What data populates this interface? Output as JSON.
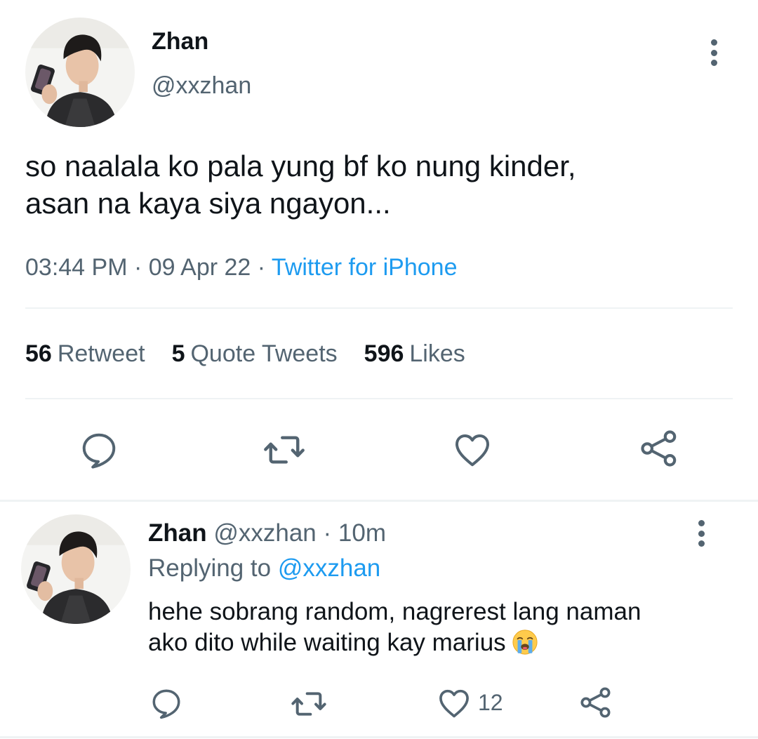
{
  "tweet": {
    "author_name": "Zhan",
    "author_handle": "@xxzhan",
    "text_line1": "so naalala ko pala yung bf ko nung kinder,",
    "text_line2": "asan na kaya siya ngayon...",
    "time": "03:44 PM",
    "sep1": " · ",
    "date": "09 Apr 22",
    "sep2": " · ",
    "source": "Twitter for iPhone",
    "stats": {
      "retweets_count": "56",
      "retweets_label": "Retweet",
      "quotes_count": "5",
      "quotes_label": "Quote Tweets",
      "likes_count": "596",
      "likes_label": "Likes"
    },
    "actions": [
      "reply-icon",
      "retweet-icon",
      "like-icon",
      "share-icon"
    ]
  },
  "reply": {
    "author_name": "Zhan",
    "author_handle": "@xxzhan",
    "sep": " · ",
    "time_ago": "10m",
    "replying_label": "Replying to ",
    "replying_to": "@xxzhan",
    "text_line1": "hehe sobrang random, nagrerest lang naman",
    "text_line2": "ako dito while waiting kay marius",
    "emoji": "loudly-crying-face-emoji",
    "like_count": "12",
    "actions": [
      "reply-icon",
      "retweet-icon",
      "like-icon",
      "share-icon"
    ]
  },
  "colors": {
    "text_primary": "#0f1419",
    "text_secondary": "#536471",
    "accent": "#1d9bf0",
    "divider": "#eff3f4"
  }
}
